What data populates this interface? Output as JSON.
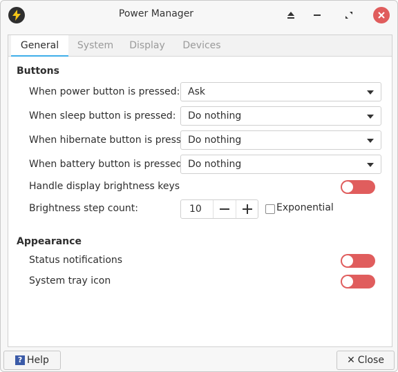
{
  "window": {
    "title": "Power Manager",
    "accent_color": "#3daee9",
    "toggle_off_color": "#e05d5d"
  },
  "titlebar": {
    "icons": [
      "power-lightning-icon",
      "eject-icon",
      "minimize-icon",
      "restore-icon",
      "close-icon"
    ]
  },
  "tabs": [
    {
      "label": "General",
      "active": true
    },
    {
      "label": "System",
      "active": false
    },
    {
      "label": "Display",
      "active": false
    },
    {
      "label": "Devices",
      "active": false
    }
  ],
  "buttons_section": {
    "title": "Buttons",
    "power_label": "When power button is pressed:",
    "power_value": "Ask",
    "sleep_label": "When sleep button is pressed:",
    "sleep_value": "Do nothing",
    "hibernate_label": "When hibernate button is pressed:",
    "hibernate_value": "Do nothing",
    "battery_label": "When battery button is pressed:",
    "battery_value": "Do nothing",
    "brightness_keys_label": "Handle display brightness keys",
    "brightness_keys_enabled": false,
    "step_label": "Brightness step count:",
    "step_value": "10",
    "exponential_label": "Exponential",
    "exponential_checked": false
  },
  "appearance_section": {
    "title": "Appearance",
    "status_label": "Status notifications",
    "status_enabled": false,
    "tray_label": "System tray icon",
    "tray_enabled": false
  },
  "footer": {
    "help_label": "Help",
    "close_label": "Close"
  }
}
